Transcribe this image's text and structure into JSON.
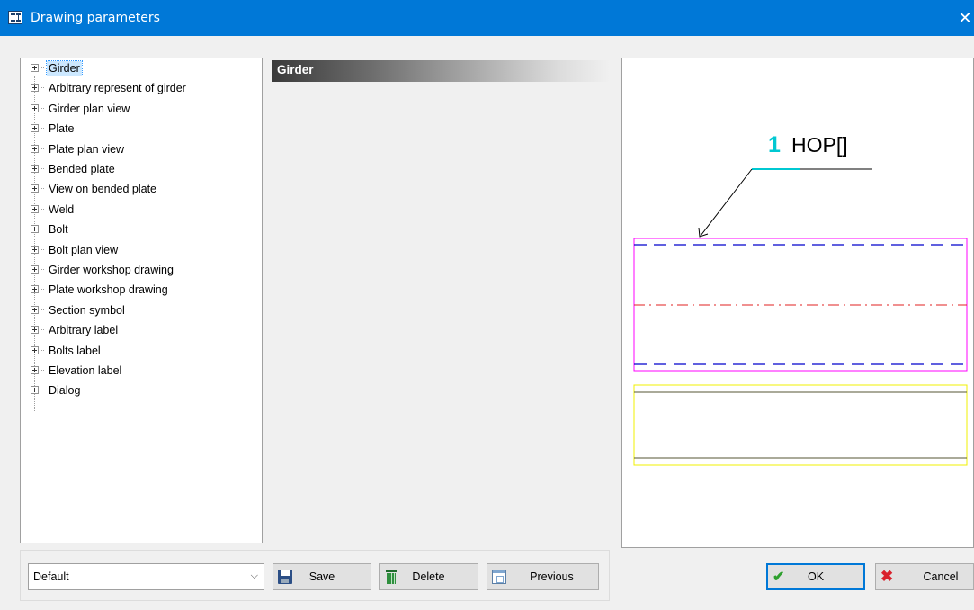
{
  "window": {
    "title": "Drawing parameters",
    "app_icon": "app-drawing-icon",
    "close_glyph": "✕"
  },
  "tree": {
    "items": [
      {
        "label": "Girder",
        "selected": true
      },
      {
        "label": "Arbitrary represent of girder"
      },
      {
        "label": "Girder plan view"
      },
      {
        "label": "Plate"
      },
      {
        "label": "Plate plan view"
      },
      {
        "label": "Bended plate"
      },
      {
        "label": "View on bended plate"
      },
      {
        "label": "Weld"
      },
      {
        "label": "Bolt"
      },
      {
        "label": "Bolt plan view"
      },
      {
        "label": "Girder workshop drawing"
      },
      {
        "label": "Plate workshop drawing"
      },
      {
        "label": "Section symbol"
      },
      {
        "label": "Arbitrary label"
      },
      {
        "label": "Bolts label"
      },
      {
        "label": "Elevation label"
      },
      {
        "label": "Dialog"
      }
    ]
  },
  "section": {
    "title": "Girder"
  },
  "preview": {
    "label_number": "1",
    "label_text": "HOP[]",
    "colors": {
      "number": "#00c8d2",
      "outline": "#ff00ff",
      "hidden_line": "#0000cc",
      "center_line": "#e02020",
      "section_outline": "#f0f000",
      "section_line": "#555533"
    }
  },
  "footer": {
    "preset": {
      "selected": "Default",
      "arrow": "⌵"
    },
    "save_label": "Save",
    "delete_label": "Delete",
    "previous_label": "Previous",
    "ok_label": "OK",
    "cancel_label": "Cancel",
    "ok_glyph": "✔",
    "cancel_glyph": "✖"
  }
}
